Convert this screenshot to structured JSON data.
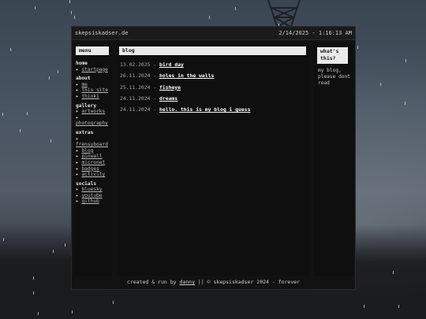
{
  "titlebar": {
    "site": "skepsiskadser.de",
    "datetime": "2/14/2025 - 1:16:13 AM"
  },
  "menu": {
    "heading": "menu",
    "sections": [
      {
        "title": "home",
        "items": [
          "startpage"
        ]
      },
      {
        "title": "about",
        "items": [
          "me",
          "this site",
          "thinki"
        ]
      },
      {
        "title": "gallery",
        "items": [
          "artworks",
          "photography"
        ]
      },
      {
        "title": "extras",
        "items": [
          "frensyboard",
          "blog",
          "pinwall",
          "micronet",
          "badges",
          "activity"
        ]
      },
      {
        "title": "socials",
        "items": [
          "bluesky",
          "youtube",
          "github"
        ]
      }
    ]
  },
  "main": {
    "heading": "blog",
    "posts": [
      {
        "date": "13.02.2025",
        "sep": " - ",
        "title": "bird day"
      },
      {
        "date": "26.11.2024",
        "sep": " - ",
        "title": "holes in the walls"
      },
      {
        "date": "25.11.2024",
        "sep": " - ",
        "title": "fisheye"
      },
      {
        "date": "24.11.2024",
        "sep": " - ",
        "title": "dreams"
      },
      {
        "date": "24.11.2024",
        "sep": " - ",
        "title": "hello. this is my blog i guess"
      }
    ]
  },
  "aside": {
    "heading": "what's this?",
    "text": "my blog, please dont read"
  },
  "footer": {
    "prefix": "created & run by ",
    "author": "danny",
    "suffix": " || © skepsiskadser 2024 - forever"
  },
  "colors": {
    "window": "#121212",
    "panel_head": "#eaeaea",
    "text": "#d8d8d8"
  }
}
